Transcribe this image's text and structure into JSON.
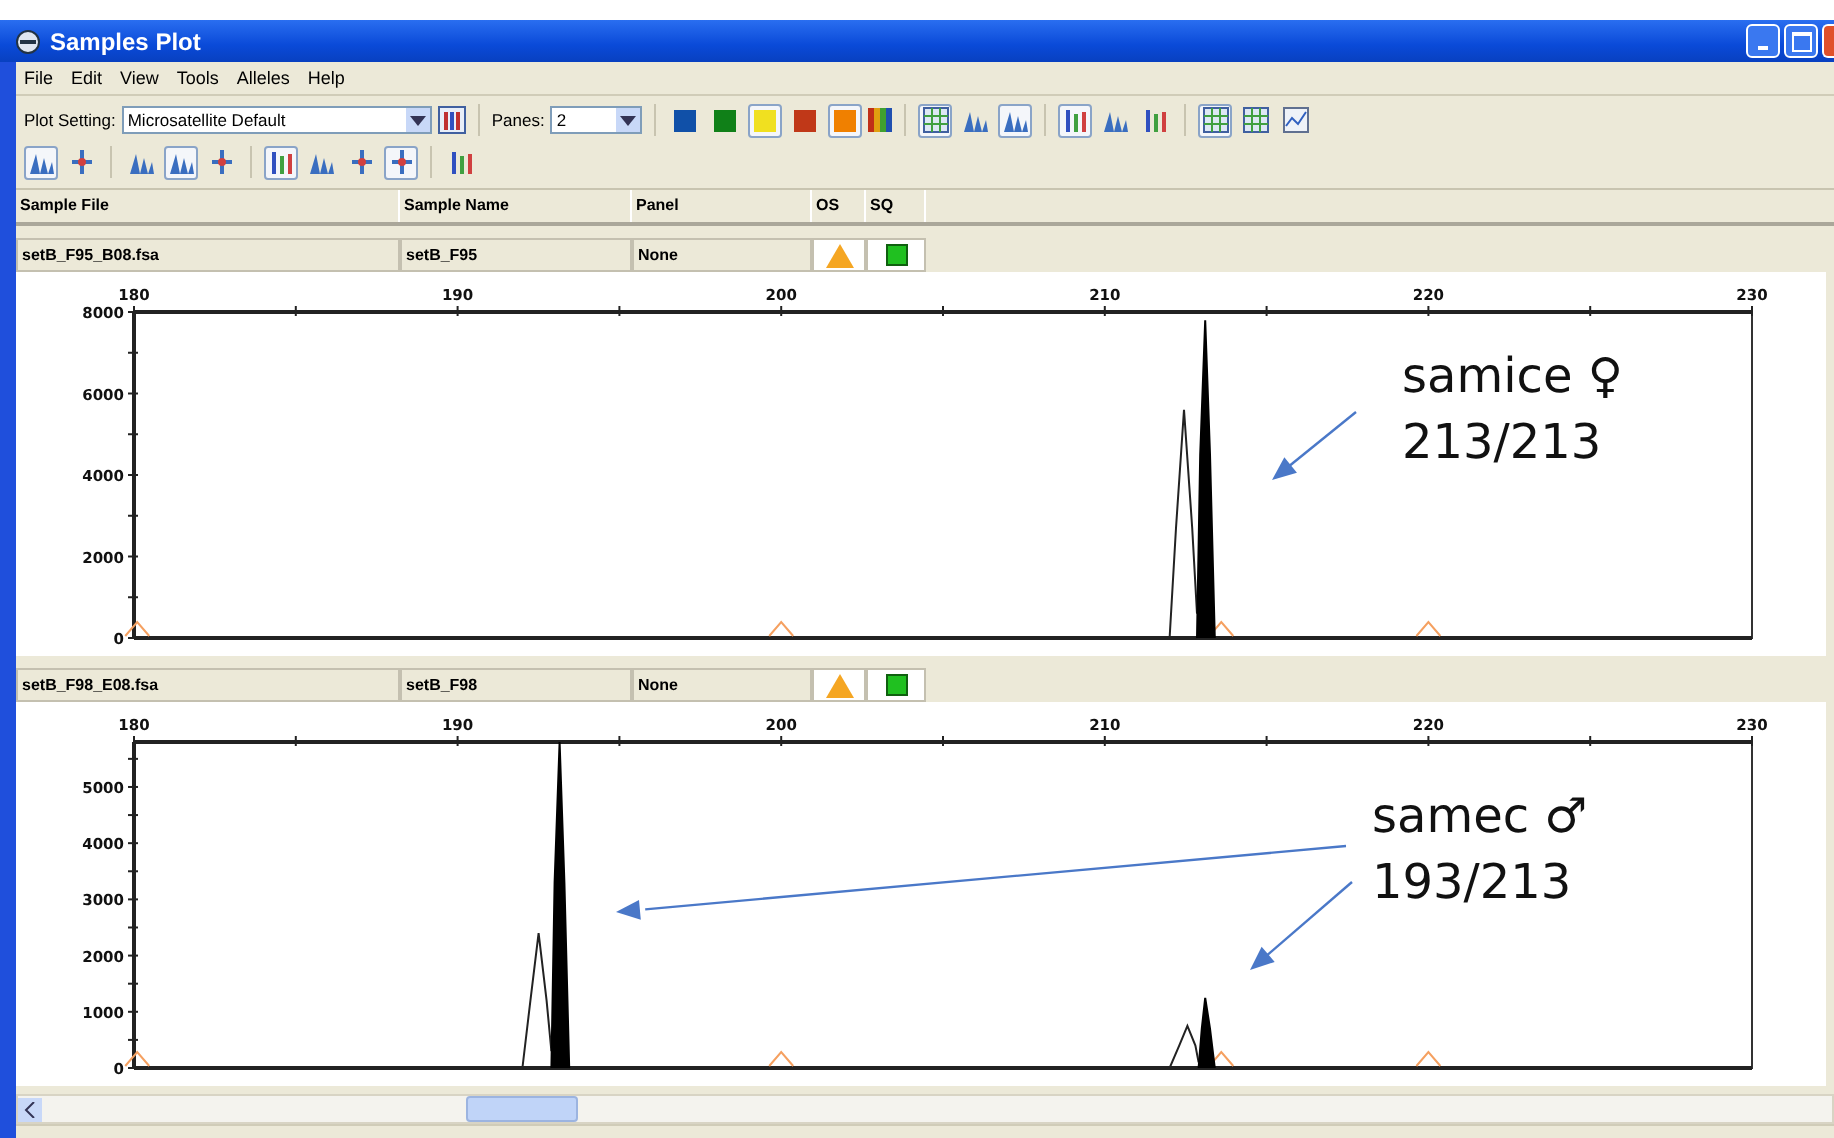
{
  "window": {
    "title": "Samples Plot"
  },
  "menu": [
    "File",
    "Edit",
    "View",
    "Tools",
    "Alleles",
    "Help"
  ],
  "toolbar": {
    "plot_setting_label": "Plot Setting:",
    "plot_setting": "Microsatellite Default",
    "panes_label": "Panes:",
    "panes": "2",
    "dye_buttons": [
      {
        "color": "#1050a8",
        "selected": false
      },
      {
        "color": "#108018",
        "selected": false
      },
      {
        "color": "#f0e020",
        "selected": true
      },
      {
        "color": "#c03818",
        "selected": false
      },
      {
        "color": "#f08000",
        "selected": true
      }
    ],
    "tool_buttons": [
      {
        "kind": "grid",
        "selected": true
      },
      {
        "kind": "peaks",
        "selected": false
      },
      {
        "kind": "peaks",
        "selected": true
      },
      {
        "kind": "bars",
        "selected": true
      },
      {
        "kind": "peaks",
        "selected": false
      },
      {
        "kind": "bars",
        "selected": false
      },
      {
        "kind": "grid",
        "selected": true
      },
      {
        "kind": "grid",
        "selected": false
      },
      {
        "kind": "chart",
        "selected": false
      }
    ],
    "view_buttons": [
      {
        "kind": "peaks",
        "selected": true
      },
      {
        "kind": "marker",
        "selected": false
      },
      {
        "kind": "peaks",
        "selected": false
      },
      {
        "kind": "peaks",
        "selected": true
      },
      {
        "kind": "marker",
        "selected": false
      },
      {
        "kind": "bars",
        "selected": true
      },
      {
        "kind": "peaks",
        "selected": false
      },
      {
        "kind": "marker",
        "selected": false
      },
      {
        "kind": "marker",
        "selected": true
      },
      {
        "kind": "bars",
        "selected": false
      }
    ]
  },
  "columns": [
    "Sample File",
    "Sample Name",
    "Panel",
    "OS",
    "SQ"
  ],
  "panes": [
    {
      "sample_file": "setB_F95_B08.fsa",
      "sample_name": "setB_F95",
      "panel": "None",
      "note": [
        "samice ♀",
        "213/213"
      ],
      "chart_data": {
        "type": "line",
        "xlim": [
          180,
          230
        ],
        "ylim": [
          0,
          8000
        ],
        "xticks": [
          180,
          190,
          200,
          210,
          220,
          230
        ],
        "yticks": [
          8000,
          6000,
          4000,
          2000,
          0
        ],
        "x": [
          180,
          212,
          212.2,
          212.45,
          212.7,
          212.85,
          212.95,
          213.1,
          213.25,
          213.4,
          213.5,
          214,
          230
        ],
        "series": [
          {
            "color": "#222222",
            "values": [
              0,
              0,
              2700,
              5600,
              2700,
              600,
              null,
              null,
              null,
              null,
              0,
              0,
              0
            ]
          },
          {
            "color": "#000000",
            "values": [
              null,
              null,
              null,
              null,
              null,
              0,
              4500,
              7800,
              4500,
              0,
              null,
              null,
              null
            ]
          }
        ]
      }
    },
    {
      "sample_file": "setB_F98_E08.fsa",
      "sample_name": "setB_F98",
      "panel": "None",
      "note": [
        "samec ♂",
        "193/213"
      ],
      "chart_data": {
        "type": "line",
        "xlim": [
          180,
          230
        ],
        "ylim": [
          0,
          5800
        ],
        "xticks": [
          180,
          190,
          200,
          210,
          220,
          230
        ],
        "yticks": [
          5000,
          4000,
          3000,
          2000,
          1000,
          0
        ],
        "x": [
          180,
          192,
          192.25,
          192.5,
          192.75,
          192.9,
          193.0,
          193.15,
          193.3,
          193.45,
          212,
          212.3,
          212.55,
          212.8,
          212.9,
          213.0,
          213.1,
          213.25,
          213.4,
          213.6,
          230
        ],
        "series": [
          {
            "color": "#222222",
            "values": [
              0,
              0,
              1200,
              2400,
              1200,
              300,
              null,
              null,
              null,
              0,
              0,
              400,
              750,
              400,
              100,
              null,
              null,
              null,
              0,
              0,
              0
            ]
          },
          {
            "color": "#000000",
            "values": [
              null,
              null,
              null,
              null,
              null,
              0,
              3300,
              5800,
              3300,
              0,
              null,
              null,
              null,
              null,
              0,
              700,
              1250,
              700,
              0,
              null,
              null
            ]
          }
        ]
      }
    }
  ]
}
